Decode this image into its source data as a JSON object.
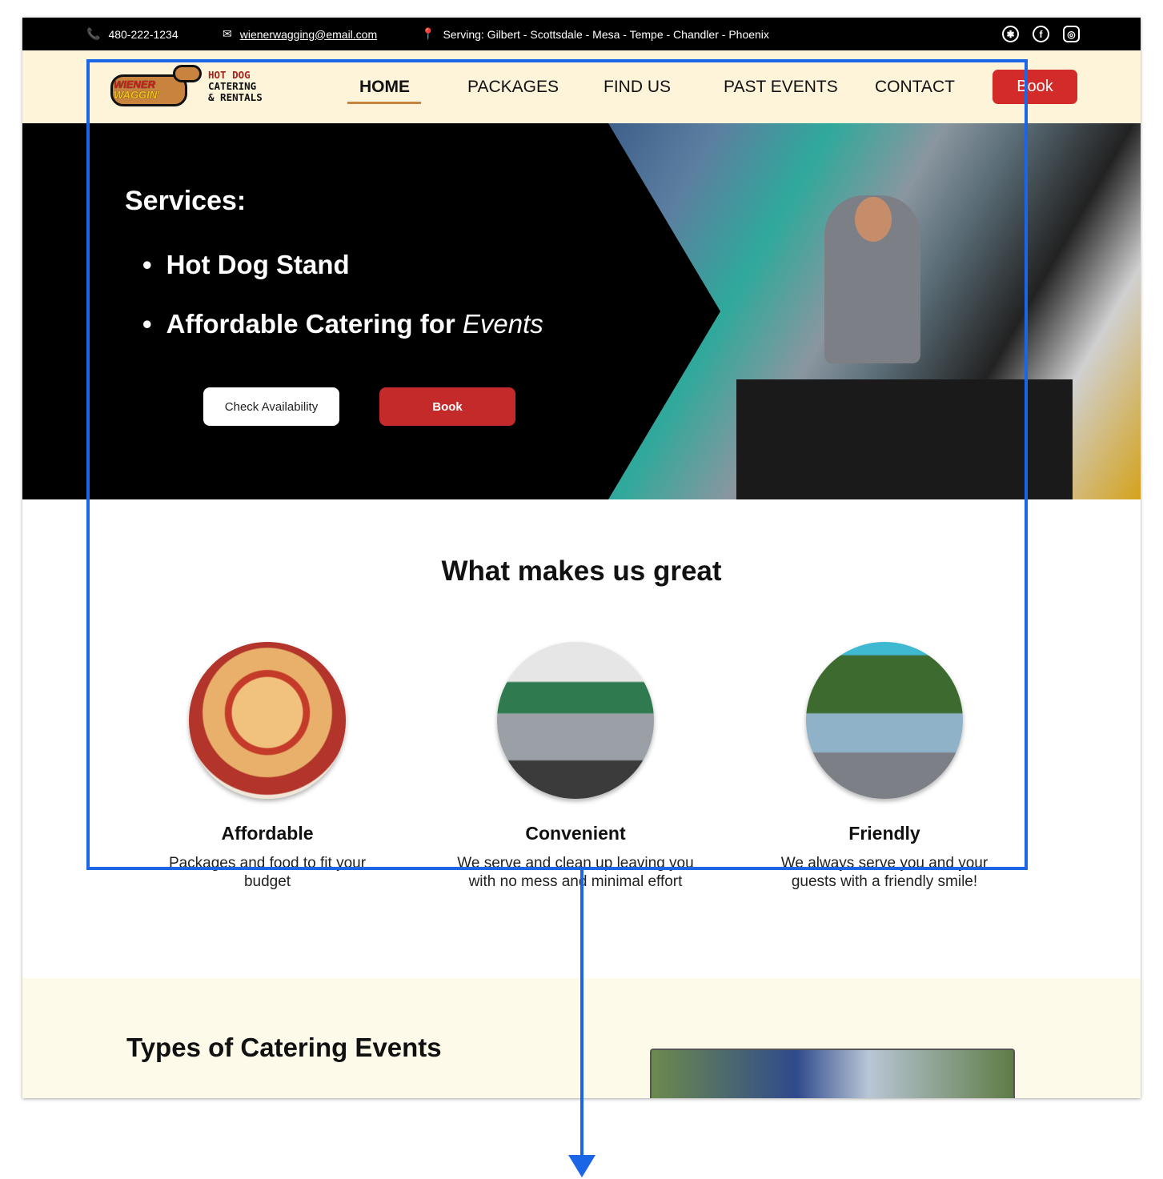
{
  "topbar": {
    "phone": "480-222-1234",
    "email": "wienerwagging@email.com",
    "serving": "Serving: Gilbert - Scottsdale - Mesa - Tempe - Chandler - Phoenix",
    "social": [
      "yelp-icon",
      "facebook-icon",
      "instagram-icon"
    ]
  },
  "logo": {
    "dog_text1": "WIENER",
    "dog_text2": "WAGGIN'",
    "line1": "HOT DOG",
    "line2": "CATERING",
    "line3": "& RENTALS"
  },
  "nav": {
    "items": [
      "HOME",
      "PACKAGES",
      "FIND US",
      "PAST EVENTS",
      "CONTACT"
    ],
    "active": "HOME",
    "book": "Book"
  },
  "hero": {
    "title": "Services:",
    "item1": "Hot Dog Stand",
    "item2": "Affordable Catering for",
    "item2_em": "Events",
    "check": "Check Availability",
    "book": "Book"
  },
  "great": {
    "title": "What makes us great",
    "features": [
      {
        "title": "Affordable",
        "text": "Packages and food to fit your budget"
      },
      {
        "title": "Convenient",
        "text": "We serve and clean up leaving you with no mess and minimal effort"
      },
      {
        "title": "Friendly",
        "text": "We always serve you and your guests with a friendly smile!"
      }
    ]
  },
  "types": {
    "title": "Types of Catering Events"
  },
  "colors": {
    "accent_red": "#d32a2a",
    "nav_bg": "#fdf4da",
    "underline": "#c8843f",
    "overlay_blue": "#1a66e6"
  }
}
